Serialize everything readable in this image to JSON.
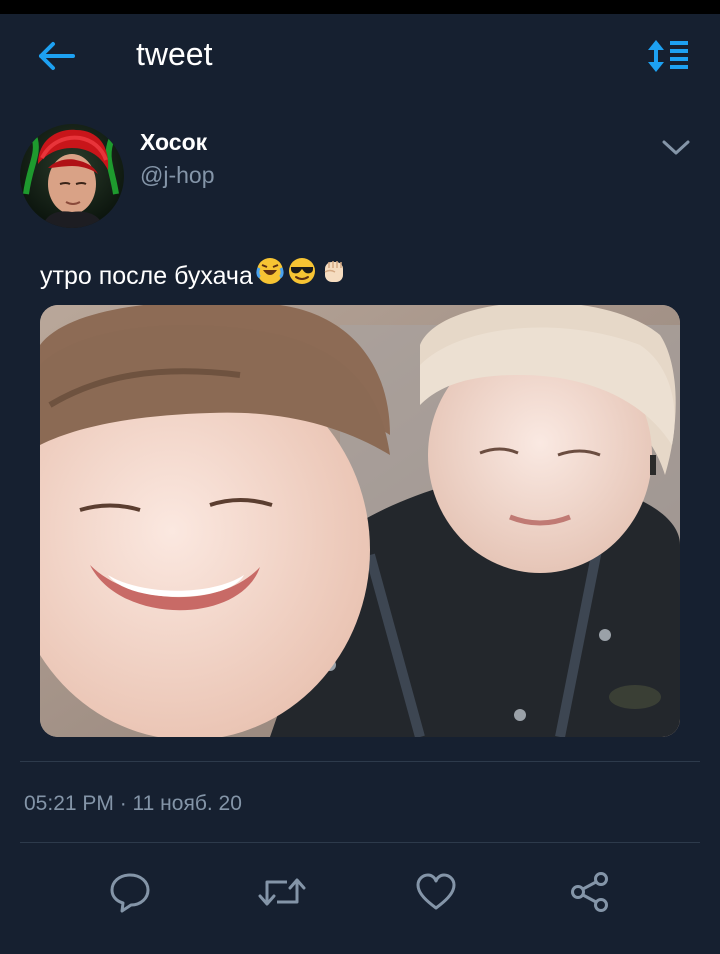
{
  "header": {
    "title": "tweet",
    "back_icon": "arrow-left-icon",
    "sort_icon": "sort-list-icon",
    "accent_color": "#1da1f2"
  },
  "tweet": {
    "author_name": "Хосок",
    "author_handle": "@j-hop",
    "text": "утро после бухача",
    "emojis": [
      "rolling-on-floor-laughing",
      "smiling-face-with-sunglasses",
      "raised-fist"
    ],
    "timestamp": "05:21 PM · 11 нояб. 20"
  },
  "actions": [
    {
      "name": "reply",
      "icon": "speech-bubble-icon"
    },
    {
      "name": "retweet",
      "icon": "retweet-icon"
    },
    {
      "name": "like",
      "icon": "heart-icon"
    },
    {
      "name": "share",
      "icon": "share-icon"
    }
  ],
  "colors": {
    "background": "#162030",
    "secondary_text": "#8495a8",
    "divider": "#2d3a4b"
  }
}
